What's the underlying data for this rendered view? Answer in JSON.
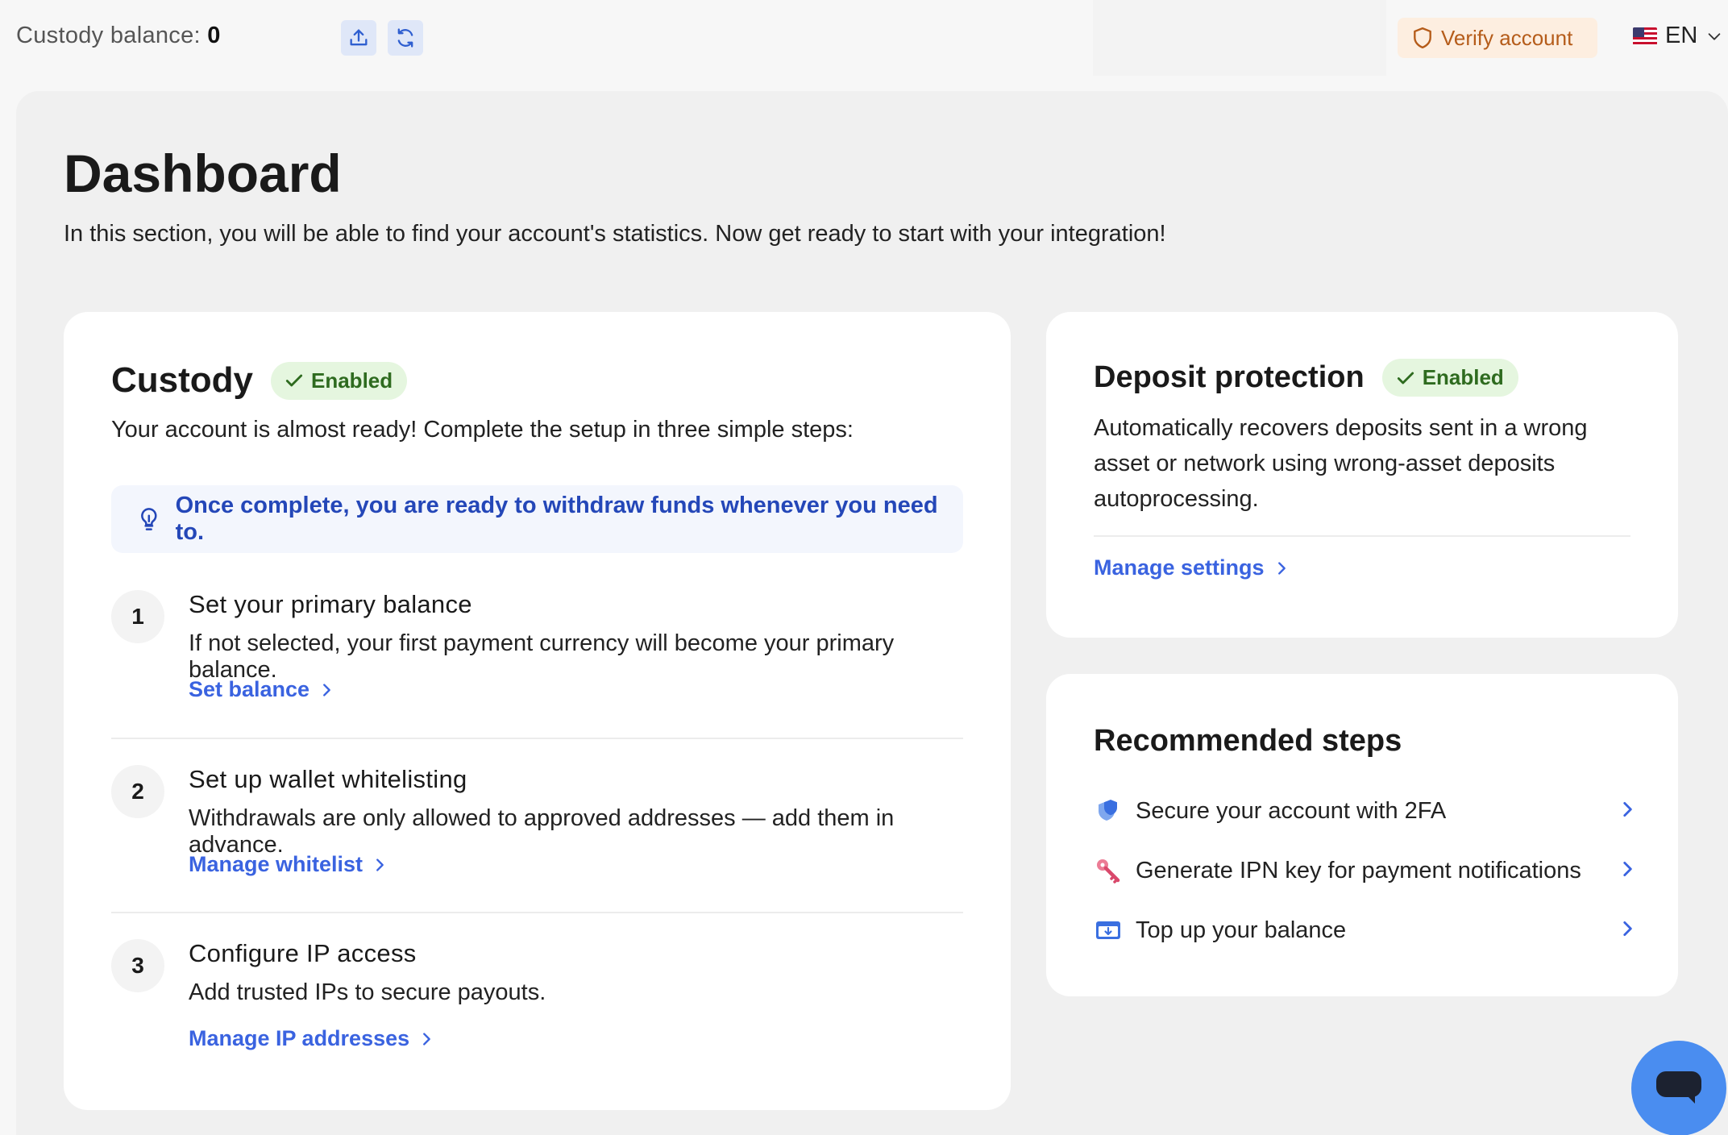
{
  "topbar": {
    "balance_label": "Custody balance: ",
    "balance_value": "0",
    "verify_label": "Verify account",
    "language": "EN"
  },
  "page": {
    "title": "Dashboard",
    "subtitle": "In this section, you will be able to find your account's statistics. Now get ready to start with your integration!"
  },
  "custody": {
    "title": "Custody",
    "badge": "Enabled",
    "description": "Your account is almost ready! Complete the setup in three simple steps:",
    "tip": "Once complete, you are ready to withdraw funds whenever you need to.",
    "steps": [
      {
        "number": "1",
        "title": "Set your primary balance",
        "description": "If not selected, your first payment currency will become your primary balance.",
        "link": "Set balance"
      },
      {
        "number": "2",
        "title": "Set up wallet whitelisting",
        "description": "Withdrawals are only allowed to approved addresses — add them in advance.",
        "link": "Manage whitelist"
      },
      {
        "number": "3",
        "title": "Configure IP access",
        "description": "Add trusted IPs to secure payouts.",
        "link": "Manage IP addresses"
      }
    ]
  },
  "deposit": {
    "title": "Deposit protection",
    "badge": "Enabled",
    "description": "Automatically recovers deposits sent in a wrong asset or network using wrong-asset deposits autoprocessing.",
    "link": "Manage settings"
  },
  "recommended": {
    "title": "Recommended steps",
    "items": [
      {
        "label": "Secure your account with 2FA",
        "icon": "shield-icon"
      },
      {
        "label": "Generate IPN key for payment notifications",
        "icon": "key-icon"
      },
      {
        "label": "Top up your balance",
        "icon": "wallet-topup-icon"
      }
    ]
  },
  "colors": {
    "accent": "#3a63e0",
    "tip_text": "#2447b8",
    "badge_bg": "#e5f6df",
    "badge_text": "#2e6b1f",
    "verify_bg": "#fdeee0",
    "verify_text": "#b55c1a",
    "chat_bg": "#4a8df0"
  }
}
